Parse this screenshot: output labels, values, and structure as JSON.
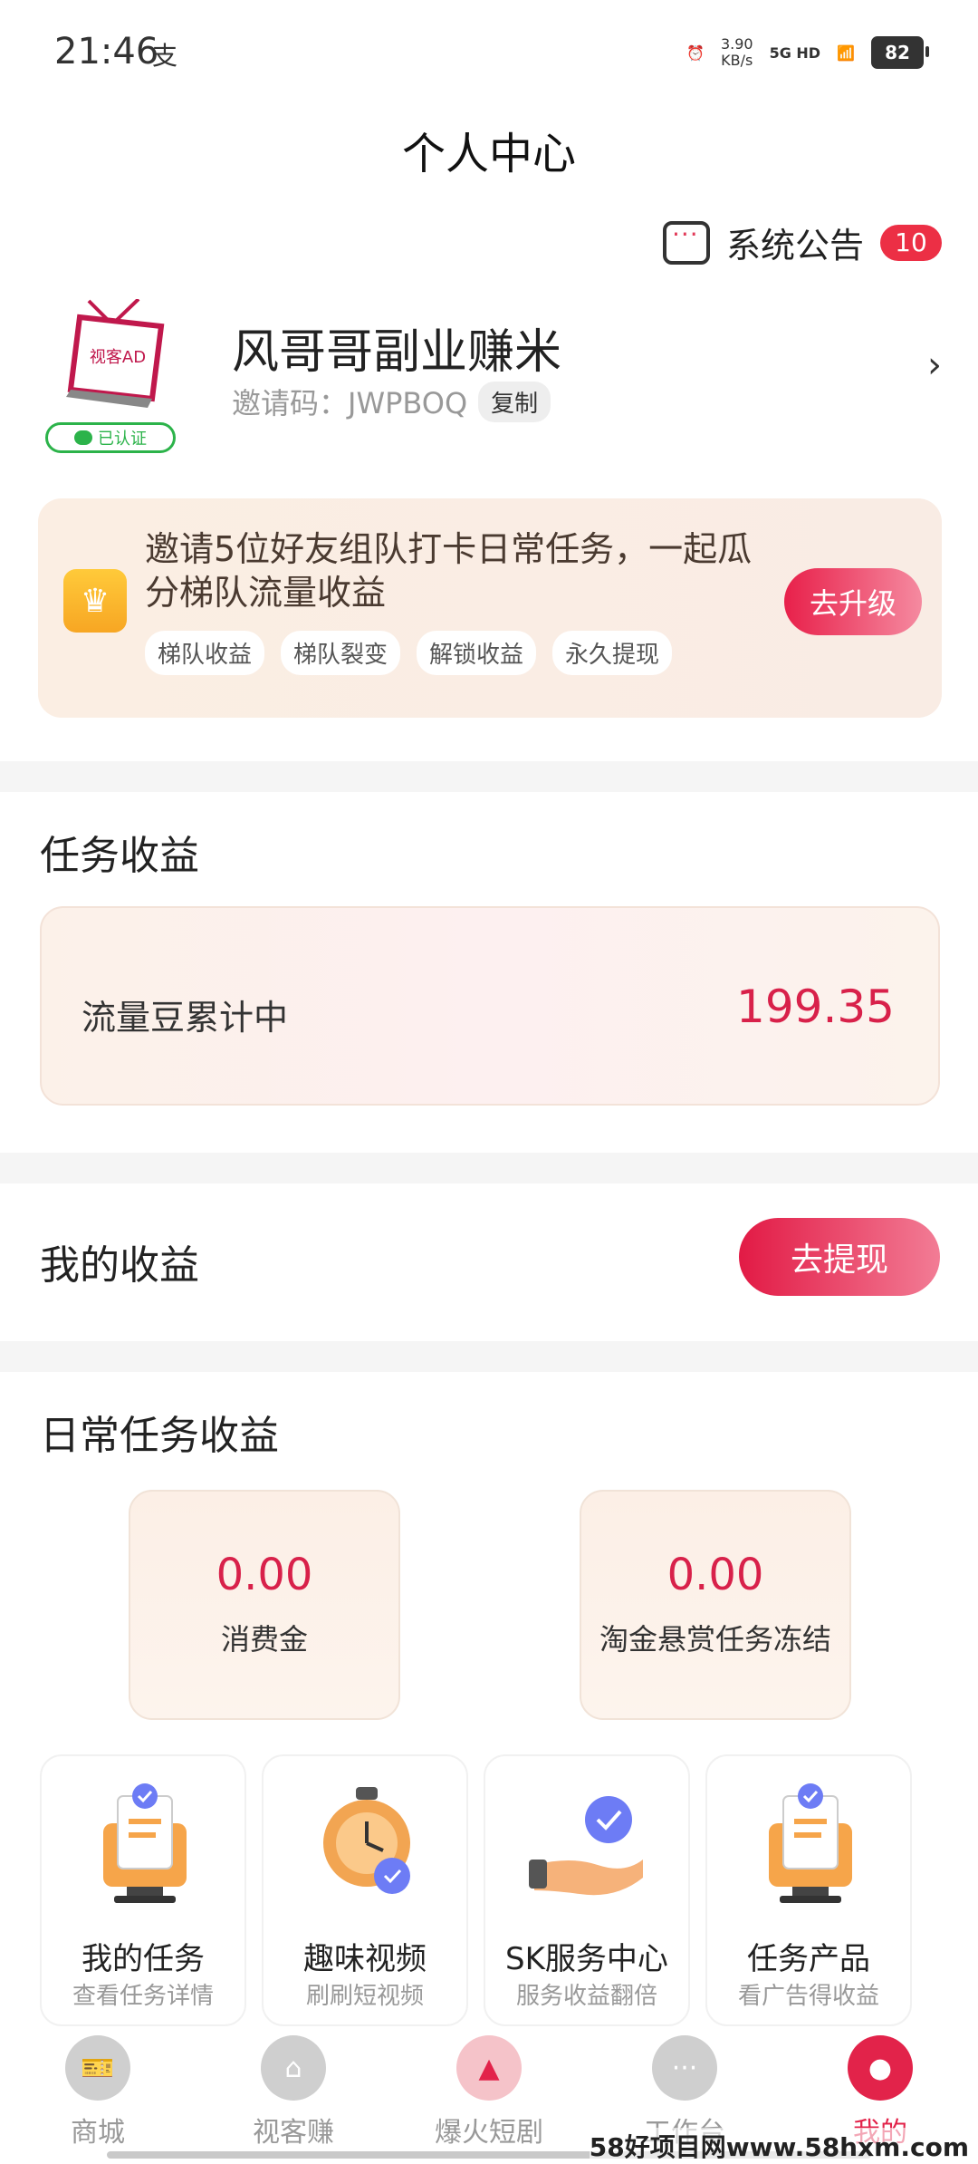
{
  "status_bar": {
    "time": "21:46",
    "extra": "支",
    "net_speed": "3.90",
    "net_unit": "KB/s",
    "signal": "5G HD",
    "battery": "82"
  },
  "header": {
    "title": "个人中心"
  },
  "notice": {
    "label": "系统公告",
    "badge": "10"
  },
  "profile": {
    "avatar_text": "视客AD",
    "verified": "已认证",
    "name": "风哥哥副业赚米",
    "invite_label": "邀请码：JWPBOQ",
    "copy": "复制"
  },
  "upgrade": {
    "text": "邀请5位好友组队打卡日常任务，一起瓜分梯队流量收益",
    "tags": [
      "梯队收益",
      "梯队裂变",
      "解锁收益",
      "永久提现"
    ],
    "button": "去升级"
  },
  "task_income": {
    "title": "任务收益",
    "label": "流量豆累计中",
    "value": "199.35"
  },
  "my_income": {
    "title": "我的收益",
    "button": "去提现"
  },
  "daily": {
    "title": "日常任务收益",
    "stats": [
      {
        "value": "0.00",
        "label": "消费金"
      },
      {
        "value": "0.00",
        "label": "淘金悬赏任务冻结"
      }
    ]
  },
  "tiles": [
    {
      "title": "我的任务",
      "sub": "查看任务详情",
      "icon": "clipboard-icon"
    },
    {
      "title": "趣味视频",
      "sub": "刷刷短视频",
      "icon": "stopwatch-icon"
    },
    {
      "title": "SK服务中心",
      "sub": "服务收益翻倍",
      "icon": "hand-check-icon"
    },
    {
      "title": "任务产品",
      "sub": "看广告得收益",
      "icon": "clipboard-icon"
    }
  ],
  "bottom_nav": [
    {
      "label": "商城",
      "icon": "ticket-icon"
    },
    {
      "label": "视客赚",
      "icon": "cap-icon"
    },
    {
      "label": "爆火短剧",
      "icon": "card-icon"
    },
    {
      "label": "工作台",
      "icon": "chat-icon"
    },
    {
      "label": "我的",
      "icon": "person-icon",
      "active": true
    }
  ],
  "watermark": "58好项目网www.58hxm.com",
  "colors": {
    "accent": "#e2234a",
    "verified": "#2cb34a"
  }
}
